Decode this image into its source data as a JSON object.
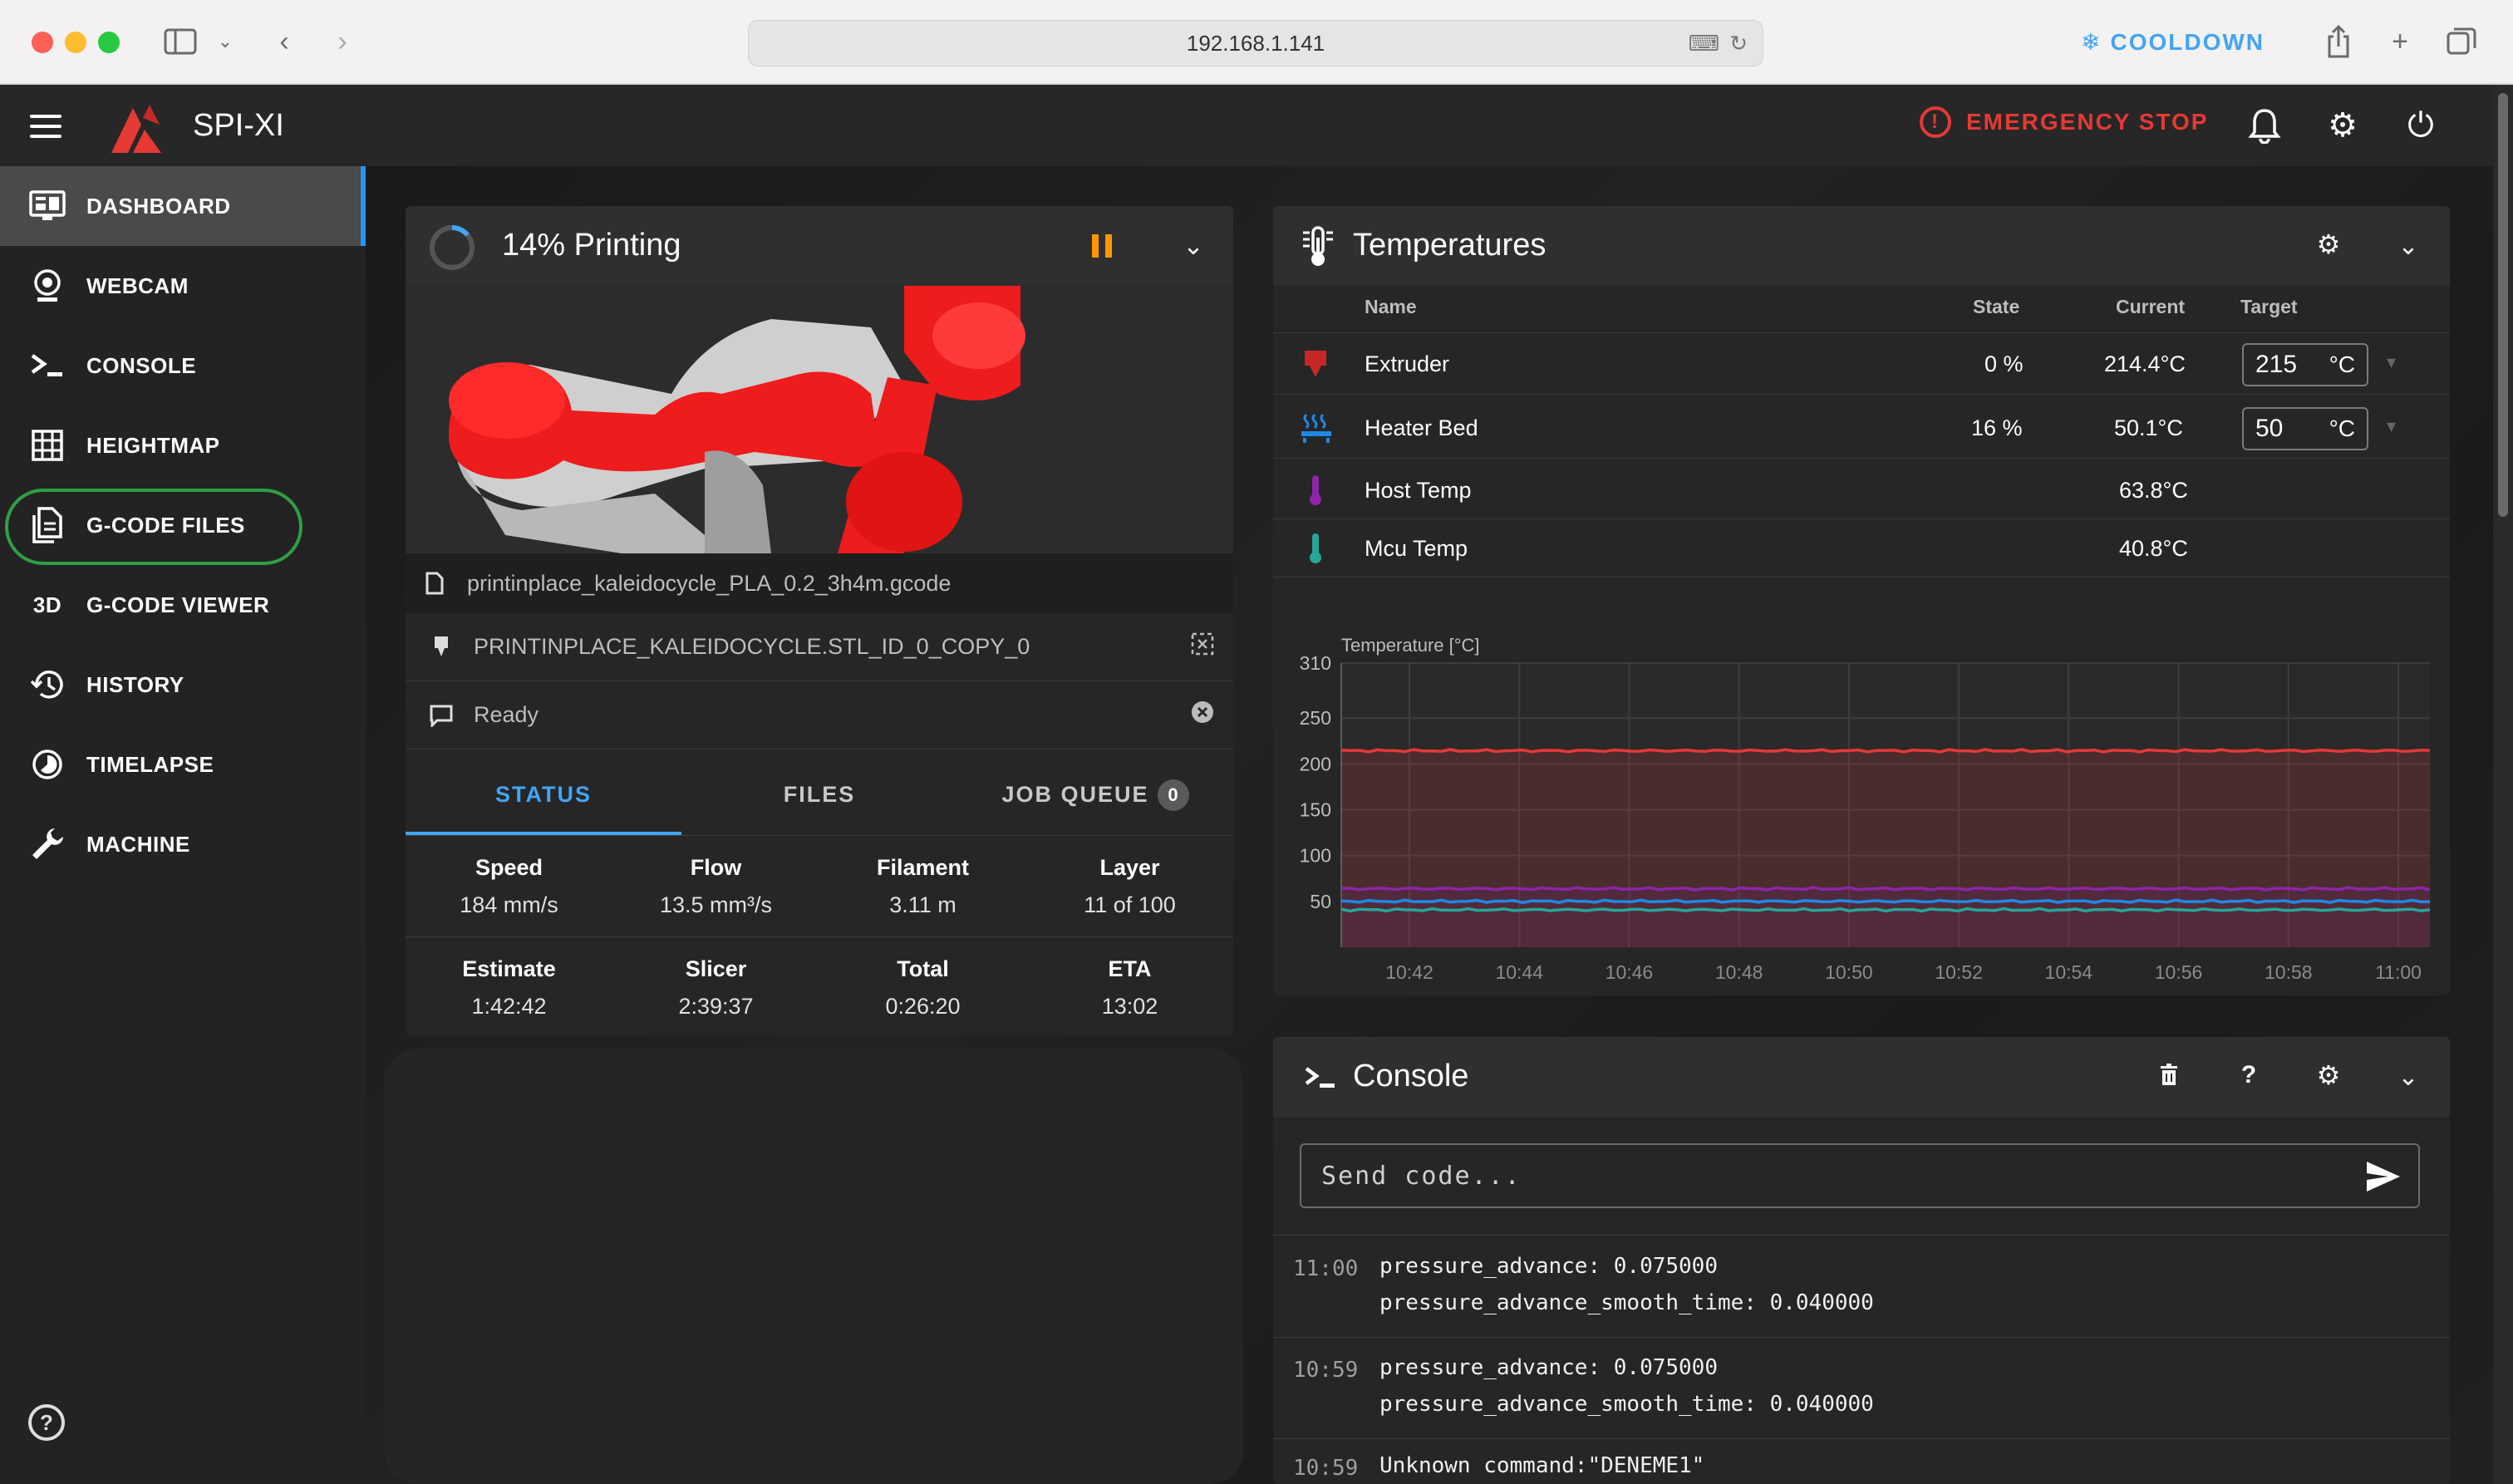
{
  "browser": {
    "url": "192.168.1.141"
  },
  "app": {
    "title": "SPI-XI",
    "emergency_stop": "EMERGENCY STOP",
    "brand_color": "#e53935",
    "accent_color": "#2196f3"
  },
  "sidebar": {
    "items": [
      {
        "label": "DASHBOARD",
        "icon": "monitor-dashboard-icon",
        "active": true
      },
      {
        "label": "WEBCAM",
        "icon": "webcam-icon"
      },
      {
        "label": "CONSOLE",
        "icon": "console-icon"
      },
      {
        "label": "HEIGHTMAP",
        "icon": "grid-icon"
      },
      {
        "label": "G-CODE FILES",
        "icon": "file-document-icon",
        "highlighted": true
      },
      {
        "label": "G-CODE VIEWER",
        "icon": "3d-icon",
        "icon_text": "3D"
      },
      {
        "label": "HISTORY",
        "icon": "history-icon"
      },
      {
        "label": "TIMELAPSE",
        "icon": "timelapse-icon"
      },
      {
        "label": "MACHINE",
        "icon": "wrench-icon"
      }
    ]
  },
  "print": {
    "title": "14% Printing",
    "progress": 0.14,
    "filename": "printinplace_kaleidocycle_PLA_0.2_3h4m.gcode",
    "object": "PRINTINPLACE_KALEIDOCYCLE.STL_ID_0_COPY_0",
    "status": "Ready",
    "tabs": {
      "status": "STATUS",
      "files": "FILES",
      "job_queue": "JOB QUEUE",
      "queue_count": "0"
    },
    "stats_row1": [
      {
        "label": "Speed",
        "value": "184 mm/s"
      },
      {
        "label": "Flow",
        "value": "13.5 mm³/s"
      },
      {
        "label": "Filament",
        "value": "3.11 m"
      },
      {
        "label": "Layer",
        "value": "11 of 100"
      }
    ],
    "stats_row2": [
      {
        "label": "Estimate",
        "value": "1:42:42"
      },
      {
        "label": "Slicer",
        "value": "2:39:37"
      },
      {
        "label": "Total",
        "value": "0:26:20"
      },
      {
        "label": "ETA",
        "value": "13:02"
      }
    ]
  },
  "temperatures": {
    "title": "Temperatures",
    "cooldown": "COOLDOWN",
    "headers": {
      "name": "Name",
      "state": "State",
      "current": "Current",
      "target": "Target"
    },
    "rows": [
      {
        "name": "Extruder",
        "state": "0 %",
        "current": "214.4°C",
        "target": "215",
        "unit": "°C",
        "icon": "extruder-icon",
        "color": "#e53935"
      },
      {
        "name": "Heater Bed",
        "state": "16 %",
        "current": "50.1°C",
        "target": "50",
        "unit": "°C",
        "icon": "heater-bed-icon",
        "color": "#1e88e5"
      },
      {
        "name": "Host Temp",
        "state": "",
        "current": "63.8°C",
        "icon": "thermometer-icon",
        "color": "#8e24aa"
      },
      {
        "name": "Mcu Temp",
        "state": "",
        "current": "40.8°C",
        "icon": "thermometer-icon",
        "color": "#26a69a"
      }
    ]
  },
  "chart_data": {
    "type": "line",
    "ylabel": "Temperature [°C]",
    "ylim": [
      0,
      310
    ],
    "yticks": [
      50,
      100,
      150,
      200,
      250,
      310
    ],
    "x": [
      "10:42",
      "10:44",
      "10:46",
      "10:48",
      "10:50",
      "10:52",
      "10:54",
      "10:56",
      "10:58",
      "11:00"
    ],
    "grid": true,
    "series": [
      {
        "name": "Extruder",
        "color": "#e53935",
        "values": [
          214.4,
          214.4,
          214.4,
          214.4,
          214.4,
          214.4,
          214.4,
          214.4,
          214.4,
          214.4
        ]
      },
      {
        "name": "Host Temp",
        "color": "#8e24aa",
        "values": [
          63.8,
          63.8,
          63.8,
          63.8,
          63.8,
          63.8,
          63.8,
          63.8,
          63.8,
          63.8
        ]
      },
      {
        "name": "Heater Bed",
        "color": "#1e88e5",
        "values": [
          50.1,
          50.1,
          50.1,
          50.1,
          50.1,
          50.1,
          50.1,
          50.1,
          50.1,
          50.1
        ]
      },
      {
        "name": "Mcu Temp",
        "color": "#26a69a",
        "values": [
          40.8,
          40.8,
          40.8,
          40.8,
          40.8,
          40.8,
          40.8,
          40.8,
          40.8,
          40.8
        ]
      }
    ]
  },
  "console": {
    "title": "Console",
    "placeholder": "Send code...",
    "entries": [
      {
        "time": "11:00",
        "message": "pressure_advance: 0.075000\npressure_advance_smooth_time: 0.040000"
      },
      {
        "time": "10:59",
        "message": "pressure_advance: 0.075000\npressure_advance_smooth_time: 0.040000"
      },
      {
        "time": "10:59",
        "message": "Unknown command:\"DENEME1\""
      }
    ]
  }
}
